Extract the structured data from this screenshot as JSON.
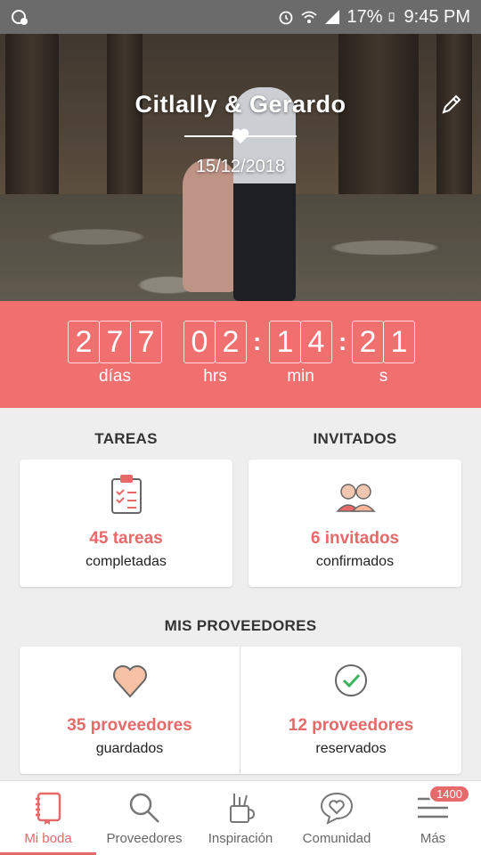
{
  "status_bar": {
    "battery": "17%",
    "time": "9:45 PM"
  },
  "hero": {
    "couple": "Citlally & Gerardo",
    "date": "15/12/2018"
  },
  "countdown": {
    "days": [
      "2",
      "7",
      "7"
    ],
    "hours": [
      "0",
      "2"
    ],
    "minutes": [
      "1",
      "4"
    ],
    "seconds": [
      "2",
      "1"
    ],
    "labels": {
      "days": "días",
      "hours": "hrs",
      "minutes": "min",
      "seconds": "s"
    }
  },
  "tareas": {
    "title": "TAREAS",
    "count": "45 tareas",
    "sub": "completadas"
  },
  "invitados": {
    "title": "INVITADOS",
    "count": "6 invitados",
    "sub": "confirmados"
  },
  "proveedores": {
    "title": "MIS PROVEEDORES",
    "saved_count": "35 proveedores",
    "saved_sub": "guardados",
    "reserved_count": "12 proveedores",
    "reserved_sub": "reservados"
  },
  "nav": {
    "items": [
      {
        "label": "Mi boda",
        "icon": "notebook-icon"
      },
      {
        "label": "Proveedores",
        "icon": "search-icon"
      },
      {
        "label": "Inspiración",
        "icon": "tools-cup-icon"
      },
      {
        "label": "Comunidad",
        "icon": "chat-heart-icon"
      },
      {
        "label": "Más",
        "icon": "menu-icon"
      }
    ],
    "badge": "1400"
  },
  "colors": {
    "accent": "#e56a69",
    "countdown_bg": "#f0706f"
  }
}
